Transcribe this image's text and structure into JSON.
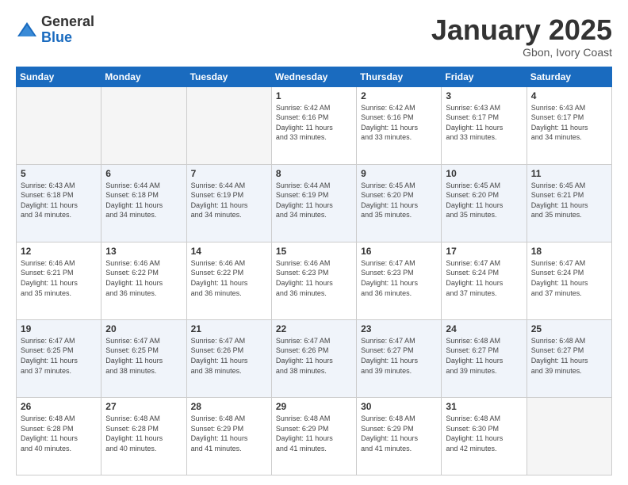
{
  "logo": {
    "general": "General",
    "blue": "Blue"
  },
  "header": {
    "month": "January 2025",
    "location": "Gbon, Ivory Coast"
  },
  "weekdays": [
    "Sunday",
    "Monday",
    "Tuesday",
    "Wednesday",
    "Thursday",
    "Friday",
    "Saturday"
  ],
  "weeks": [
    [
      {
        "day": "",
        "info": ""
      },
      {
        "day": "",
        "info": ""
      },
      {
        "day": "",
        "info": ""
      },
      {
        "day": "1",
        "info": "Sunrise: 6:42 AM\nSunset: 6:16 PM\nDaylight: 11 hours\nand 33 minutes."
      },
      {
        "day": "2",
        "info": "Sunrise: 6:42 AM\nSunset: 6:16 PM\nDaylight: 11 hours\nand 33 minutes."
      },
      {
        "day": "3",
        "info": "Sunrise: 6:43 AM\nSunset: 6:17 PM\nDaylight: 11 hours\nand 33 minutes."
      },
      {
        "day": "4",
        "info": "Sunrise: 6:43 AM\nSunset: 6:17 PM\nDaylight: 11 hours\nand 34 minutes."
      }
    ],
    [
      {
        "day": "5",
        "info": "Sunrise: 6:43 AM\nSunset: 6:18 PM\nDaylight: 11 hours\nand 34 minutes."
      },
      {
        "day": "6",
        "info": "Sunrise: 6:44 AM\nSunset: 6:18 PM\nDaylight: 11 hours\nand 34 minutes."
      },
      {
        "day": "7",
        "info": "Sunrise: 6:44 AM\nSunset: 6:19 PM\nDaylight: 11 hours\nand 34 minutes."
      },
      {
        "day": "8",
        "info": "Sunrise: 6:44 AM\nSunset: 6:19 PM\nDaylight: 11 hours\nand 34 minutes."
      },
      {
        "day": "9",
        "info": "Sunrise: 6:45 AM\nSunset: 6:20 PM\nDaylight: 11 hours\nand 35 minutes."
      },
      {
        "day": "10",
        "info": "Sunrise: 6:45 AM\nSunset: 6:20 PM\nDaylight: 11 hours\nand 35 minutes."
      },
      {
        "day": "11",
        "info": "Sunrise: 6:45 AM\nSunset: 6:21 PM\nDaylight: 11 hours\nand 35 minutes."
      }
    ],
    [
      {
        "day": "12",
        "info": "Sunrise: 6:46 AM\nSunset: 6:21 PM\nDaylight: 11 hours\nand 35 minutes."
      },
      {
        "day": "13",
        "info": "Sunrise: 6:46 AM\nSunset: 6:22 PM\nDaylight: 11 hours\nand 36 minutes."
      },
      {
        "day": "14",
        "info": "Sunrise: 6:46 AM\nSunset: 6:22 PM\nDaylight: 11 hours\nand 36 minutes."
      },
      {
        "day": "15",
        "info": "Sunrise: 6:46 AM\nSunset: 6:23 PM\nDaylight: 11 hours\nand 36 minutes."
      },
      {
        "day": "16",
        "info": "Sunrise: 6:47 AM\nSunset: 6:23 PM\nDaylight: 11 hours\nand 36 minutes."
      },
      {
        "day": "17",
        "info": "Sunrise: 6:47 AM\nSunset: 6:24 PM\nDaylight: 11 hours\nand 37 minutes."
      },
      {
        "day": "18",
        "info": "Sunrise: 6:47 AM\nSunset: 6:24 PM\nDaylight: 11 hours\nand 37 minutes."
      }
    ],
    [
      {
        "day": "19",
        "info": "Sunrise: 6:47 AM\nSunset: 6:25 PM\nDaylight: 11 hours\nand 37 minutes."
      },
      {
        "day": "20",
        "info": "Sunrise: 6:47 AM\nSunset: 6:25 PM\nDaylight: 11 hours\nand 38 minutes."
      },
      {
        "day": "21",
        "info": "Sunrise: 6:47 AM\nSunset: 6:26 PM\nDaylight: 11 hours\nand 38 minutes."
      },
      {
        "day": "22",
        "info": "Sunrise: 6:47 AM\nSunset: 6:26 PM\nDaylight: 11 hours\nand 38 minutes."
      },
      {
        "day": "23",
        "info": "Sunrise: 6:47 AM\nSunset: 6:27 PM\nDaylight: 11 hours\nand 39 minutes."
      },
      {
        "day": "24",
        "info": "Sunrise: 6:48 AM\nSunset: 6:27 PM\nDaylight: 11 hours\nand 39 minutes."
      },
      {
        "day": "25",
        "info": "Sunrise: 6:48 AM\nSunset: 6:27 PM\nDaylight: 11 hours\nand 39 minutes."
      }
    ],
    [
      {
        "day": "26",
        "info": "Sunrise: 6:48 AM\nSunset: 6:28 PM\nDaylight: 11 hours\nand 40 minutes."
      },
      {
        "day": "27",
        "info": "Sunrise: 6:48 AM\nSunset: 6:28 PM\nDaylight: 11 hours\nand 40 minutes."
      },
      {
        "day": "28",
        "info": "Sunrise: 6:48 AM\nSunset: 6:29 PM\nDaylight: 11 hours\nand 41 minutes."
      },
      {
        "day": "29",
        "info": "Sunrise: 6:48 AM\nSunset: 6:29 PM\nDaylight: 11 hours\nand 41 minutes."
      },
      {
        "day": "30",
        "info": "Sunrise: 6:48 AM\nSunset: 6:29 PM\nDaylight: 11 hours\nand 41 minutes."
      },
      {
        "day": "31",
        "info": "Sunrise: 6:48 AM\nSunset: 6:30 PM\nDaylight: 11 hours\nand 42 minutes."
      },
      {
        "day": "",
        "info": ""
      }
    ]
  ]
}
